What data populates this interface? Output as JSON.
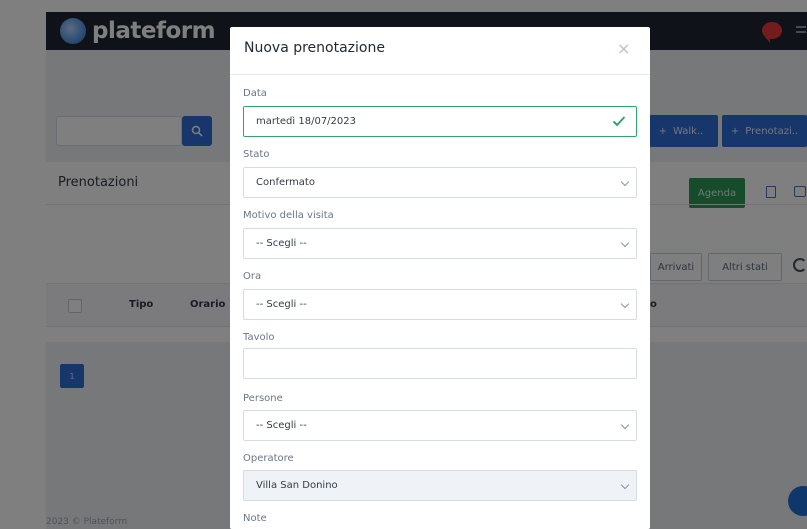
{
  "app": {
    "brand": "plateform",
    "brand_tagline": "",
    "buttons": {
      "walkin": "Walk..",
      "prenota": "Prenotazi..",
      "agenda": "Agenda",
      "arrivati": "Arrivati",
      "altri_stati": "Altri stati",
      "plus": "+"
    },
    "panel_title": "Prenotazioni",
    "table_headers": {
      "tipo": "Tipo",
      "orario": "Orario",
      "truncated": "o"
    },
    "pagination_current": "1",
    "footer": "2023 © Plateform"
  },
  "icons": {
    "search": "search-icon",
    "chat": "chat-icon",
    "check": "check-icon",
    "close": "close-icon",
    "caret": "chevron-down-icon"
  },
  "colors": {
    "primary": "#2f6dd6",
    "success": "#2b9a55",
    "valid_border": "#2fa56a",
    "topbar": "#1e2733",
    "chat": "#e8373d"
  },
  "modal": {
    "title": "Nuova prenotazione",
    "close": "×",
    "fields": {
      "data": {
        "label": "Data",
        "value": "martedì 18/07/2023"
      },
      "stato": {
        "label": "Stato",
        "value": "Confermato"
      },
      "motivo": {
        "label": "Motivo della visita",
        "value": "-- Scegli --"
      },
      "ora": {
        "label": "Ora",
        "value": "-- Scegli --"
      },
      "tavolo": {
        "label": "Tavolo",
        "value": ""
      },
      "persone": {
        "label": "Persone",
        "value": "-- Scegli --"
      },
      "operatore": {
        "label": "Operatore",
        "value": "Villa San Donino"
      },
      "note": {
        "label": "Note"
      }
    }
  }
}
